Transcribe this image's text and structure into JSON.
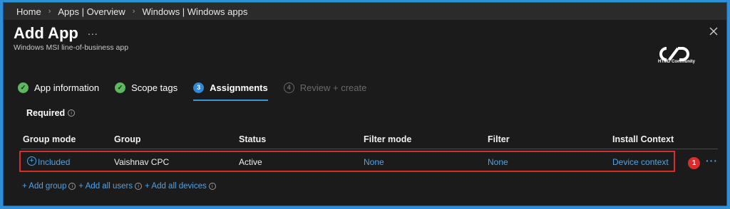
{
  "breadcrumb": [
    "Home",
    "Apps | Overview",
    "Windows | Windows apps"
  ],
  "header": {
    "title": "Add App",
    "more_label": "...",
    "subtitle": "Windows MSI line-of-business app",
    "logo_text": "HTMD Community"
  },
  "steps": [
    {
      "label": "App information",
      "state": "done",
      "marker": "✓"
    },
    {
      "label": "Scope tags",
      "state": "done",
      "marker": "✓"
    },
    {
      "label": "Assignments",
      "state": "current",
      "marker": "3"
    },
    {
      "label": "Review + create",
      "state": "disabled",
      "marker": "4"
    }
  ],
  "section": {
    "label": "Required",
    "info": "i"
  },
  "table": {
    "headers": [
      "Group mode",
      "Group",
      "Status",
      "Filter mode",
      "Filter",
      "Install Context"
    ],
    "row": {
      "group_mode": "Included",
      "group": "Vaishnav CPC",
      "status": "Active",
      "filter_mode": "None",
      "filter": "None",
      "install_context": "Device context"
    },
    "row_more": "···",
    "annotation_badge": "1"
  },
  "actions": {
    "add_group": "+ Add group",
    "add_all_users": "+ Add all users",
    "add_all_devices": "+ Add all devices",
    "info": "i"
  },
  "colors": {
    "accent": "#4fa3e8",
    "success": "#5cb85c",
    "highlight": "#d92d2d",
    "background": "#1b1b1b"
  }
}
